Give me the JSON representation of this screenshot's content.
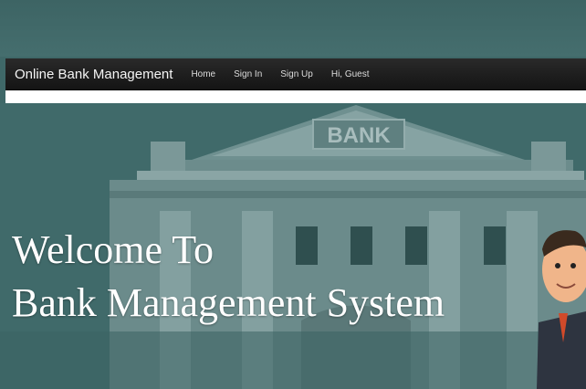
{
  "navbar": {
    "brand": "Online Bank Management",
    "links": [
      "Home",
      "Sign In",
      "Sign Up",
      "Hi, Guest"
    ]
  },
  "hero": {
    "building_sign": "BANK",
    "title_line1": "Welcome To",
    "title_line2": "Bank Management System"
  },
  "colors": {
    "background": "#406a6a",
    "navbar": "#1b1b1b",
    "building": "#7f9c9c"
  }
}
